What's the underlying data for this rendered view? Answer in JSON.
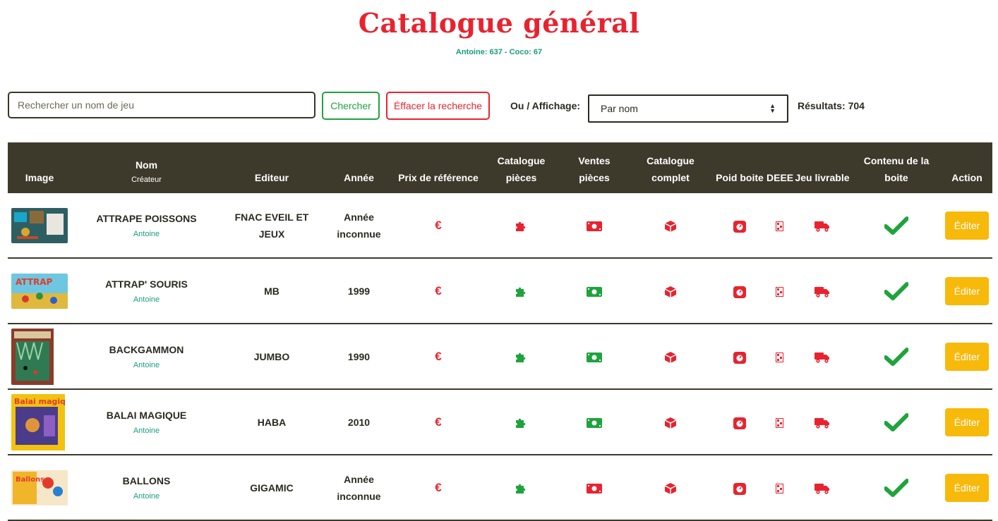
{
  "page": {
    "title": "Catalogue général",
    "subtitle": "Antoine: 637 - Coco: 67"
  },
  "search": {
    "placeholder": "Rechercher un nom de jeu",
    "value": "",
    "search_label": "Chercher",
    "clear_label": "Éffacer la recherche",
    "sort_label": "Ou / Affichage:",
    "sort_selected": "Par nom",
    "results_label": "Résultats: 704"
  },
  "colors": {
    "accent_red": "#e8232f",
    "accent_green": "#1fa33c",
    "header_bg": "#3e3a2b",
    "edit_button": "#f7b90a",
    "creator_teal": "#1a9c7d"
  },
  "table": {
    "headers": {
      "image": "Image",
      "name": "Nom",
      "creator": "Créateur",
      "publisher": "Editeur",
      "year": "Année",
      "ref_price": "Prix de référence",
      "parts_catalog": "Catalogue pièces",
      "parts_sales": "Ventes pièces",
      "full_catalog": "Catalogue complet",
      "box_weight": "Poid boite",
      "deee": "DEEE",
      "deliverable": "Jeu livrable",
      "box_content": "Contenu de la boite",
      "action": "Action"
    },
    "rows": [
      {
        "name": "ATTRAPE POISSONS",
        "creator": "Antoine",
        "publisher": "FNAC EVEIL ET JEUX",
        "year": "Année inconnue",
        "icon_price": "euro-icon",
        "parts_catalog_status": "red",
        "parts_sales_status": "red",
        "edit_label": "Éditer"
      },
      {
        "name": "ATTRAP' SOURIS",
        "creator": "Antoine",
        "publisher": "MB",
        "year": "1999",
        "icon_price": "euro-icon",
        "parts_catalog_status": "green",
        "parts_sales_status": "green",
        "edit_label": "Éditer"
      },
      {
        "name": "BACKGAMMON",
        "creator": "Antoine",
        "publisher": "JUMBO",
        "year": "1990",
        "icon_price": "euro-icon",
        "parts_catalog_status": "green",
        "parts_sales_status": "green",
        "edit_label": "Éditer"
      },
      {
        "name": "BALAI MAGIQUE",
        "creator": "Antoine",
        "publisher": "HABA",
        "year": "2010",
        "icon_price": "euro-icon",
        "parts_catalog_status": "green",
        "parts_sales_status": "green",
        "edit_label": "Éditer"
      },
      {
        "name": "BALLONS",
        "creator": "Antoine",
        "publisher": "GIGAMIC",
        "year": "Année inconnue",
        "icon_price": "euro-icon",
        "parts_catalog_status": "green",
        "parts_sales_status": "red",
        "edit_label": "Éditer"
      }
    ]
  }
}
